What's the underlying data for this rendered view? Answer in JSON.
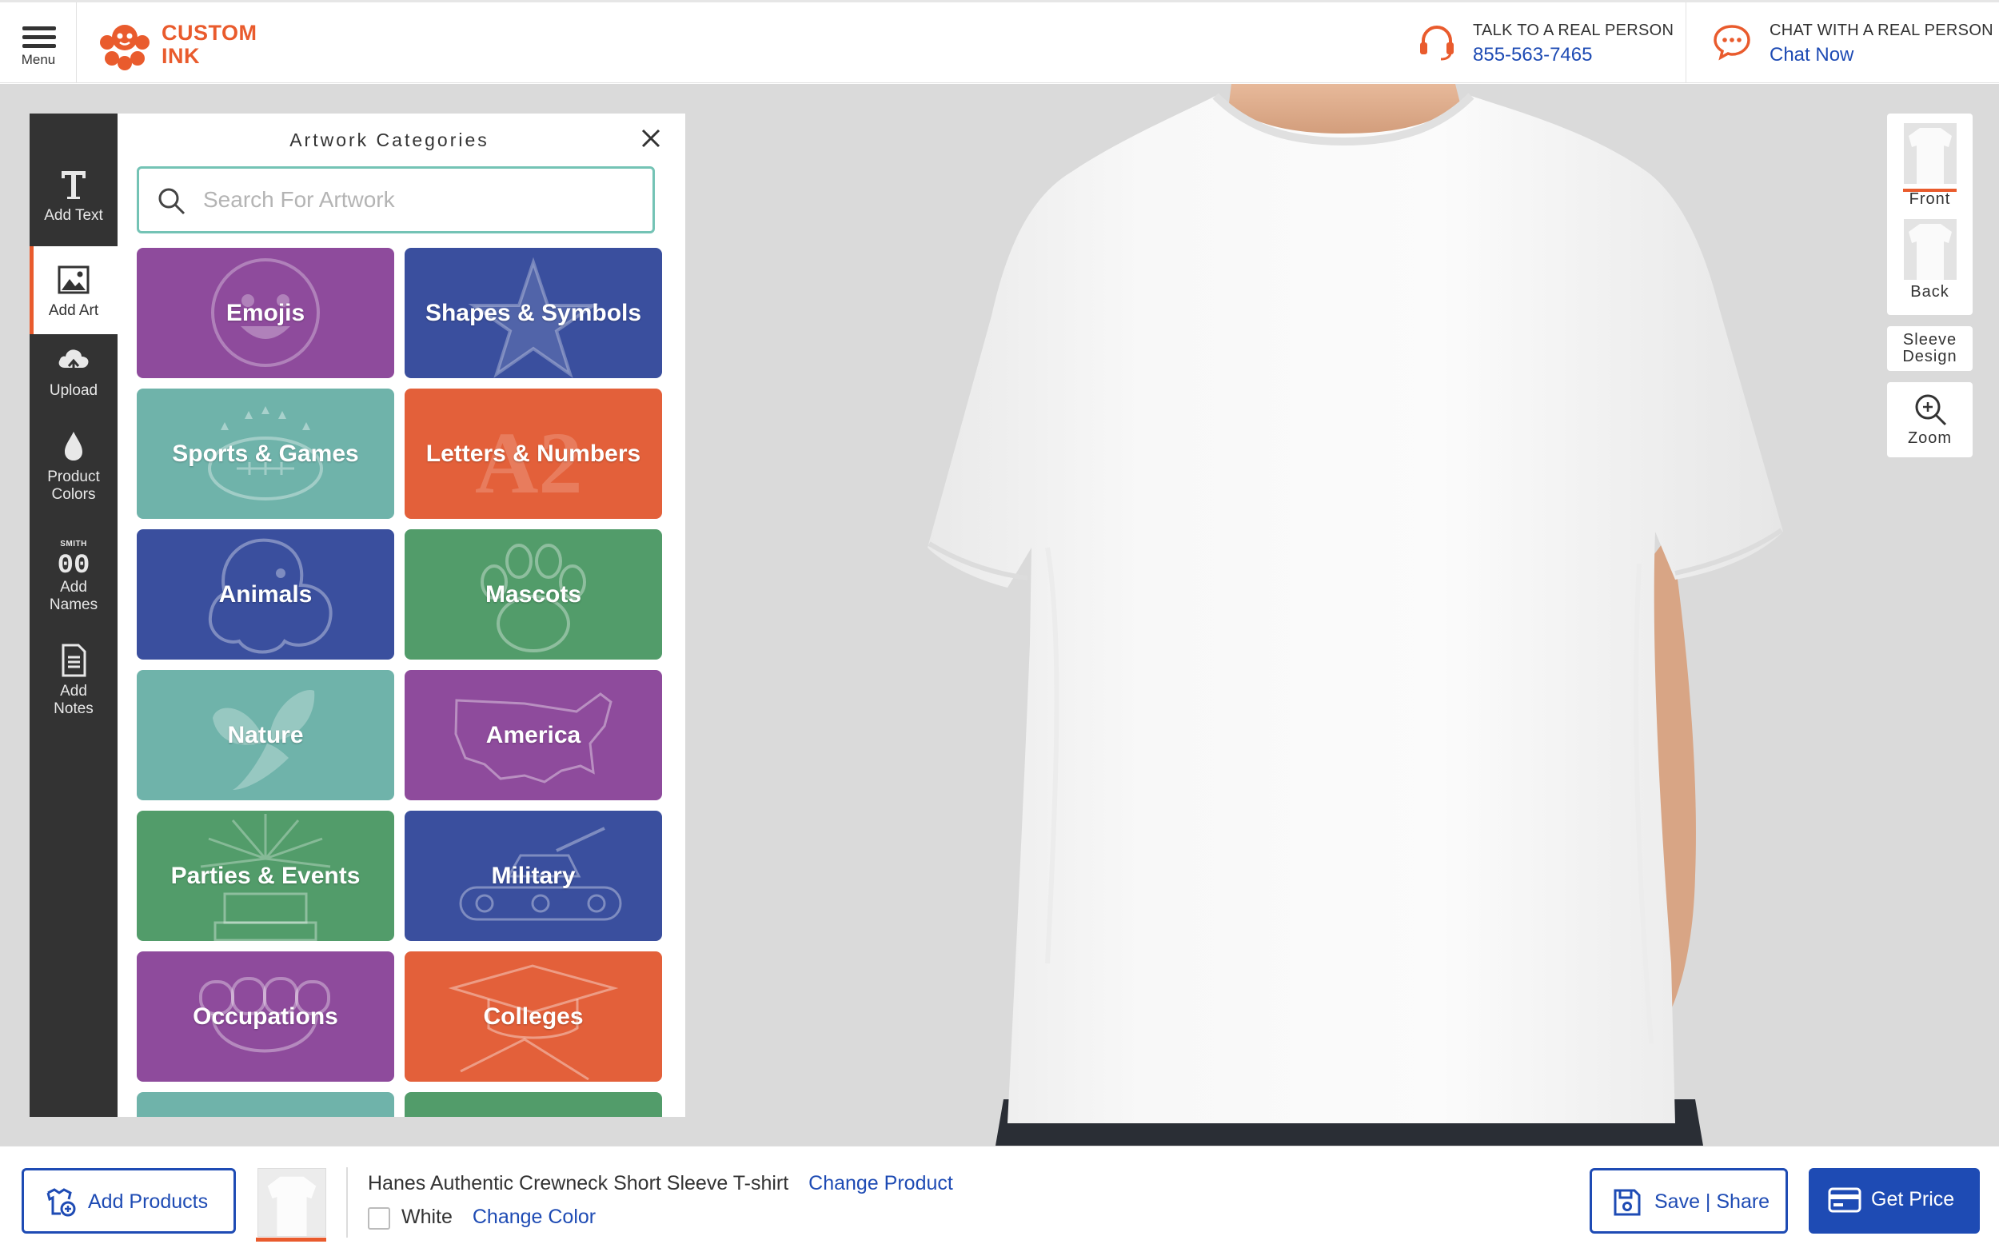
{
  "header": {
    "menu_label": "Menu",
    "logo_line1": "CUSTOM",
    "logo_line2": "INK",
    "phone_caption": "TALK TO A REAL PERSON",
    "phone_number": "855-563-7465",
    "chat_caption": "CHAT WITH A REAL PERSON",
    "chat_link": "Chat Now"
  },
  "tools": [
    {
      "label": "Add Text",
      "icon": "text-icon"
    },
    {
      "label": "Add Art",
      "icon": "image-icon",
      "active": true
    },
    {
      "label": "Upload",
      "icon": "cloud-upload-icon"
    },
    {
      "label": "Product Colors",
      "icon": "droplet-icon"
    },
    {
      "label": "Add Names",
      "icon": "names-numbers-icon",
      "icon_text": "SMITH",
      "icon_digits": "00"
    },
    {
      "label": "Add Notes",
      "icon": "notes-icon"
    }
  ],
  "panel": {
    "title": "Artwork Categories",
    "search_placeholder": "Search For Artwork",
    "categories": [
      {
        "label": "Emojis",
        "color": "#8e4b9c",
        "icon": "smiley-icon"
      },
      {
        "label": "Shapes & Symbols",
        "color": "#3a4f9e",
        "icon": "star-icon"
      },
      {
        "label": "Sports & Games",
        "color": "#6fb3aa",
        "icon": "football-icon"
      },
      {
        "label": "Letters & Numbers",
        "color": "#e3603a",
        "icon": "letters-icon"
      },
      {
        "label": "Animals",
        "color": "#3a4f9e",
        "icon": "dog-icon"
      },
      {
        "label": "Mascots",
        "color": "#529c6a",
        "icon": "paw-icon"
      },
      {
        "label": "Nature",
        "color": "#6fb3aa",
        "icon": "leaf-icon"
      },
      {
        "label": "America",
        "color": "#8e4b9c",
        "icon": "usa-map-icon"
      },
      {
        "label": "Parties & Events",
        "color": "#529c6a",
        "icon": "cake-icon"
      },
      {
        "label": "Military",
        "color": "#3a4f9e",
        "icon": "tank-icon"
      },
      {
        "label": "Occupations",
        "color": "#8e4b9c",
        "icon": "fist-icon"
      },
      {
        "label": "Colleges",
        "color": "#e3603a",
        "icon": "graduation-cap-icon"
      },
      {
        "label": "",
        "color": "#6fb3aa",
        "icon": ""
      },
      {
        "label": "",
        "color": "#529c6a",
        "icon": ""
      }
    ]
  },
  "views": {
    "front": "Front",
    "back": "Back",
    "sleeve_line1": "Sleeve",
    "sleeve_line2": "Design",
    "zoom": "Zoom"
  },
  "footer": {
    "add_products": "Add Products",
    "product_name": "Hanes Authentic Crewneck Short Sleeve T-shirt",
    "change_product": "Change Product",
    "color_name": "White",
    "change_color": "Change Color",
    "save_share": "Save | Share",
    "get_price": "Get Price"
  },
  "colors": {
    "accent": "#e95b2d",
    "link": "#1e4bb4",
    "rail": "#333333",
    "search_border": "#74c3b5"
  }
}
